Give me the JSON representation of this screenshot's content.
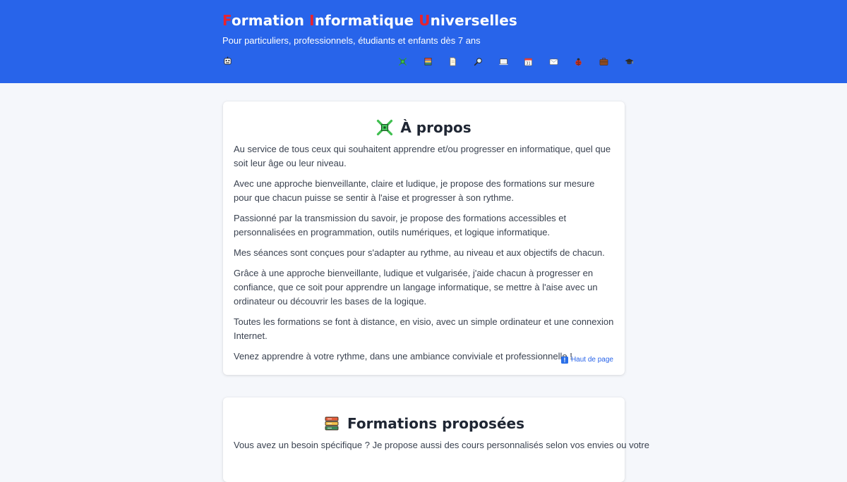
{
  "header": {
    "title_parts": [
      {
        "cap": "F",
        "rest": "ormation "
      },
      {
        "cap": "I",
        "rest": "nformatique "
      },
      {
        "cap": "U",
        "rest": "niverselles"
      }
    ],
    "subtitle": "Pour particuliers, professionnels, étudiants et enfants dès 7 ans",
    "logo_icon": "robot-face-icon",
    "accent_color": "#2864ea",
    "title_capital_color": "#e8232e"
  },
  "nav": {
    "items": [
      {
        "icon": "puzzle-piece-icon",
        "target": "a-propos"
      },
      {
        "icon": "books-icon",
        "target": "formations"
      },
      {
        "icon": "page-icon",
        "target": "documents"
      },
      {
        "icon": "magnifier-icon",
        "target": "recherche"
      },
      {
        "icon": "laptop-icon",
        "target": "visio"
      },
      {
        "icon": "calendar-icon",
        "target": "planning"
      },
      {
        "icon": "envelope-icon",
        "target": "contact"
      },
      {
        "icon": "ladybug-icon",
        "target": "debogage"
      },
      {
        "icon": "briefcase-icon",
        "target": "professionnels"
      },
      {
        "icon": "graduation-cap-icon",
        "target": "etudiants"
      }
    ]
  },
  "about": {
    "title": "À propos",
    "paragraphs": [
      "Au service de tous ceux qui souhaitent apprendre et/ou progresser en informatique, quel que soit leur âge ou leur niveau.",
      "Avec une approche bienveillante, claire et ludique, je propose des formations sur mesure pour que chacun puisse se sentir à l'aise et progresser à son rythme.",
      "Passionné par la transmission du savoir, je propose des formations accessibles et personnalisées en programmation, outils numériques, et logique informatique.",
      "Mes séances sont conçues pour s'adapter au rythme, au niveau et aux objectifs de chacun.",
      "Grâce à une approche bienveillante, ludique et vulgarisée, j'aide chacun à progresser en confiance, que ce soit pour apprendre un langage informatique, se mettre à l'aise avec un ordinateur ou découvrir les bases de la logique.",
      "Toutes les formations se font à distance, en visio, avec un simple ordinateur et une connexion Internet.",
      "Venez apprendre à votre rythme, dans une ambiance conviviale et professionnelle !"
    ],
    "back_to_top": "Haut de page"
  },
  "formations": {
    "title": "Formations proposées",
    "intro": "Vous avez un besoin spécifique ? Je propose aussi des cours personnalisés selon vos envies ou votre"
  }
}
